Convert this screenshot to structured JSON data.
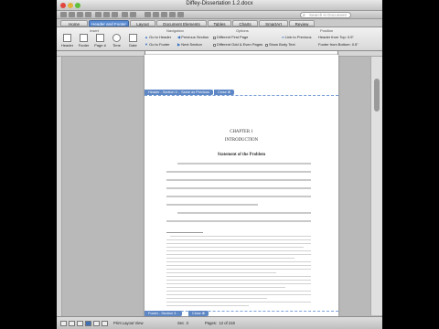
{
  "window": {
    "title": "Diffey-Dissertation 1.2.docx"
  },
  "search": {
    "placeholder": "Search in Document"
  },
  "ribbon_tabs": [
    "Home",
    "Header and Footer",
    "Layout",
    "Document Elements",
    "Tables",
    "Charts",
    "SmartArt",
    "Review"
  ],
  "ribbon": {
    "groups": {
      "insert": "Insert",
      "navigation": "Navigation",
      "options": "Options",
      "position": "Position"
    },
    "insert_buttons": [
      "Header",
      "Footer",
      "Page #",
      "Time",
      "Date"
    ],
    "nav": {
      "go_header": "Go to Header",
      "go_footer": "Go to Footer",
      "prev": "Previous Section",
      "next": "Next Section",
      "link_prev": "Link to Previous"
    },
    "options": {
      "diff_first": "Different First Page",
      "diff_odd": "Different Odd & Even Pages",
      "show_text": "Show Body Text"
    },
    "position": {
      "header_top": "Header from Top:",
      "footer_bottom": "Footer from Bottom:",
      "header_val": "0.5\"",
      "footer_val": "0.5\""
    }
  },
  "page": {
    "header_tag": "Header - Section 3 -",
    "header_same": "Same as Previous",
    "close": "Close",
    "chapter": "CHAPTER 1",
    "chapter_title": "INTRODUCTION",
    "section_heading": "Statement of the Problem",
    "footer_tag": "Footer - Section 3 -",
    "footer_close": "Close"
  },
  "status": {
    "view": "Print Layout View",
    "sec": "Sec",
    "sec_val": "3",
    "pages": "Pages:",
    "pages_val": "12 of 218"
  }
}
